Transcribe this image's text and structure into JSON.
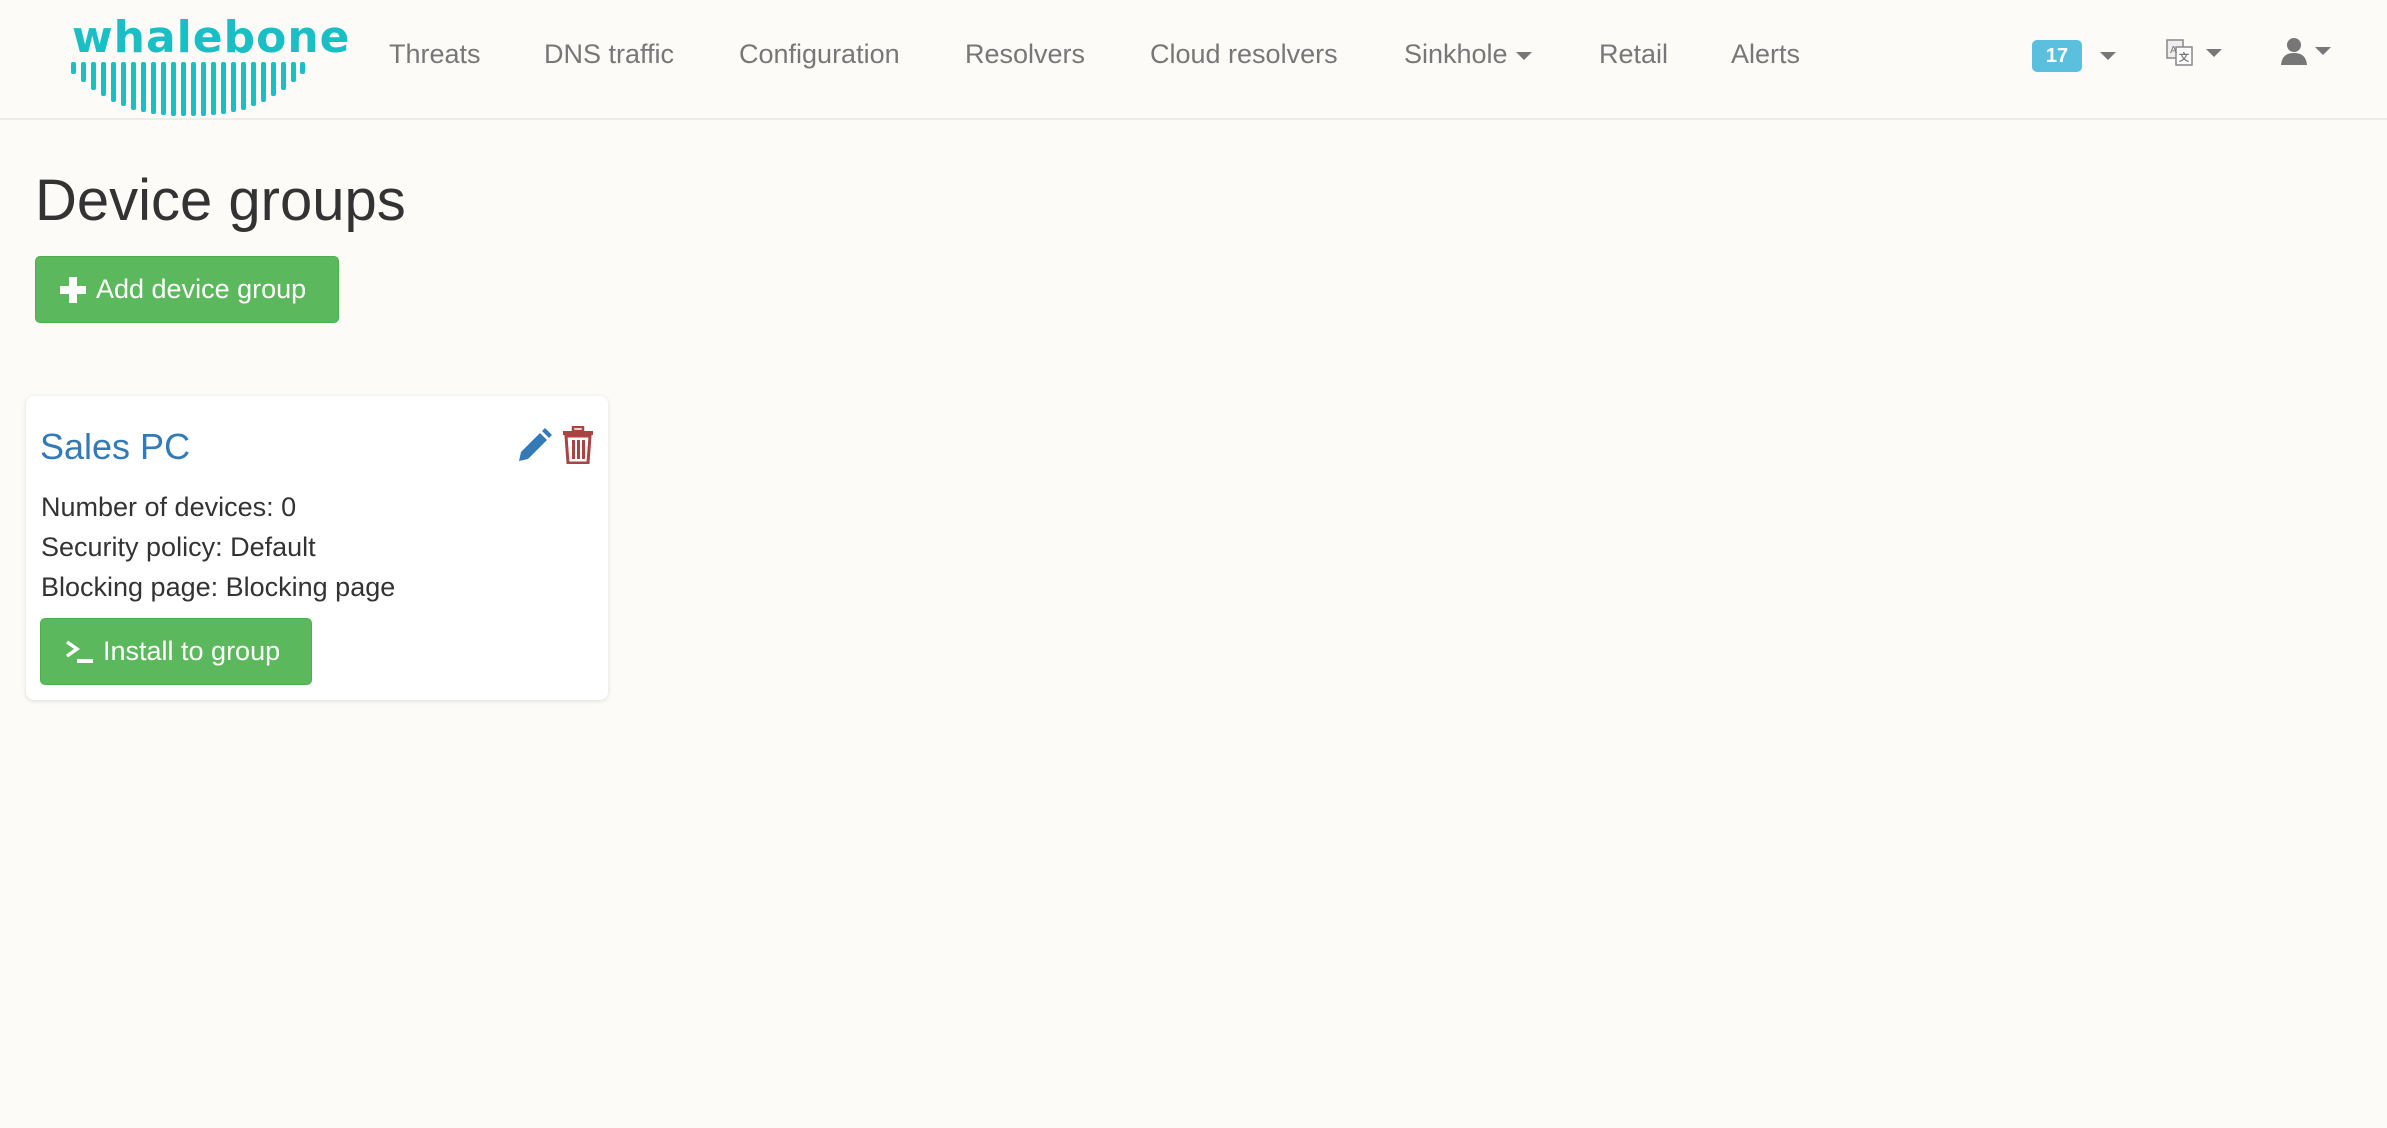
{
  "brand": {
    "logo_text": "whalebone",
    "logo_color": "#19bfc4"
  },
  "nav": {
    "items": [
      {
        "label": "Threats"
      },
      {
        "label": "DNS traffic"
      },
      {
        "label": "Configuration"
      },
      {
        "label": "Resolvers"
      },
      {
        "label": "Cloud resolvers"
      },
      {
        "label": "Sinkhole",
        "dropdown": true
      },
      {
        "label": "Retail"
      },
      {
        "label": "Alerts"
      }
    ],
    "notifications": {
      "count": "17",
      "icon": "notification-badge"
    },
    "language_icon": "translate-icon",
    "user_icon": "user-icon"
  },
  "page": {
    "title": "Device groups",
    "add_button": {
      "label": "Add device group",
      "icon": "plus-icon"
    }
  },
  "groups": [
    {
      "name": "Sales PC",
      "devices_line": "Number of devices: 0",
      "policy_line": "Security policy: Default",
      "blocking_line": "Blocking page: Blocking page",
      "install_label": "Install to group",
      "install_icon": "terminal-icon",
      "edit_icon": "pencil-icon",
      "delete_icon": "trash-icon"
    }
  ],
  "colors": {
    "primary_green": "#5cb85c",
    "link_blue": "#337ab7",
    "danger_red": "#a94442",
    "badge_blue": "#5bc0de"
  }
}
